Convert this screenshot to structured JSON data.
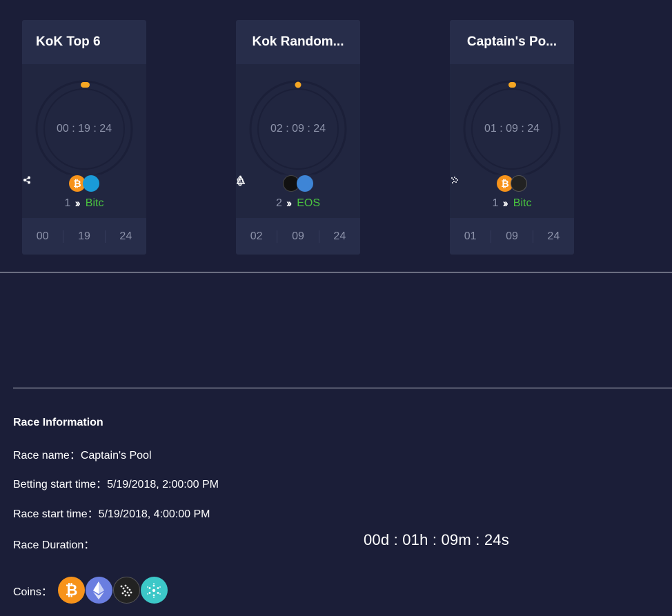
{
  "cards": [
    {
      "title": "KoK Top 6",
      "timer": "00 : 19 : 24",
      "coins": [
        "bitcoin-icon",
        "ripple-icon"
      ],
      "leader_rank": "1",
      "leader_coin": "Bitc",
      "foot": [
        "00",
        "19",
        "24"
      ]
    },
    {
      "title": "Kok Random...",
      "timer": "02 : 09 : 24",
      "coins": [
        "eos-icon",
        "ark-icon"
      ],
      "leader_rank": "2",
      "leader_coin": "EOS",
      "foot": [
        "02",
        "09",
        "24"
      ]
    },
    {
      "title": "Captain's Po...",
      "timer": "01 : 09 : 24",
      "coins": [
        "bitcoin-icon",
        "iota-icon"
      ],
      "leader_rank": "1",
      "leader_coin": "Bitc",
      "foot": [
        "01",
        "09",
        "24"
      ]
    }
  ],
  "info": {
    "heading": "Race Information",
    "race_name_label": "Race name：",
    "race_name": "Captain's Pool",
    "betting_start_label": "Betting start time：",
    "betting_start": "5/19/2018, 2:00:00 PM",
    "race_start_label": "Race start time：",
    "race_start": "5/19/2018, 4:00:00 PM",
    "duration_label": "Race Duration：",
    "duration": "00d : 01h : 09m : 24s",
    "coins_label": "Coins：",
    "coins": [
      "bitcoin-icon",
      "ethereum-icon",
      "iota-icon",
      "cardano-icon"
    ]
  },
  "colors": {
    "background": "#1b1e38",
    "card": "#212640",
    "card_header": "#272d4a",
    "accent_dot": "#f5a623",
    "leader_green": "#4ac33f",
    "muted_text": "#8d93aa"
  }
}
